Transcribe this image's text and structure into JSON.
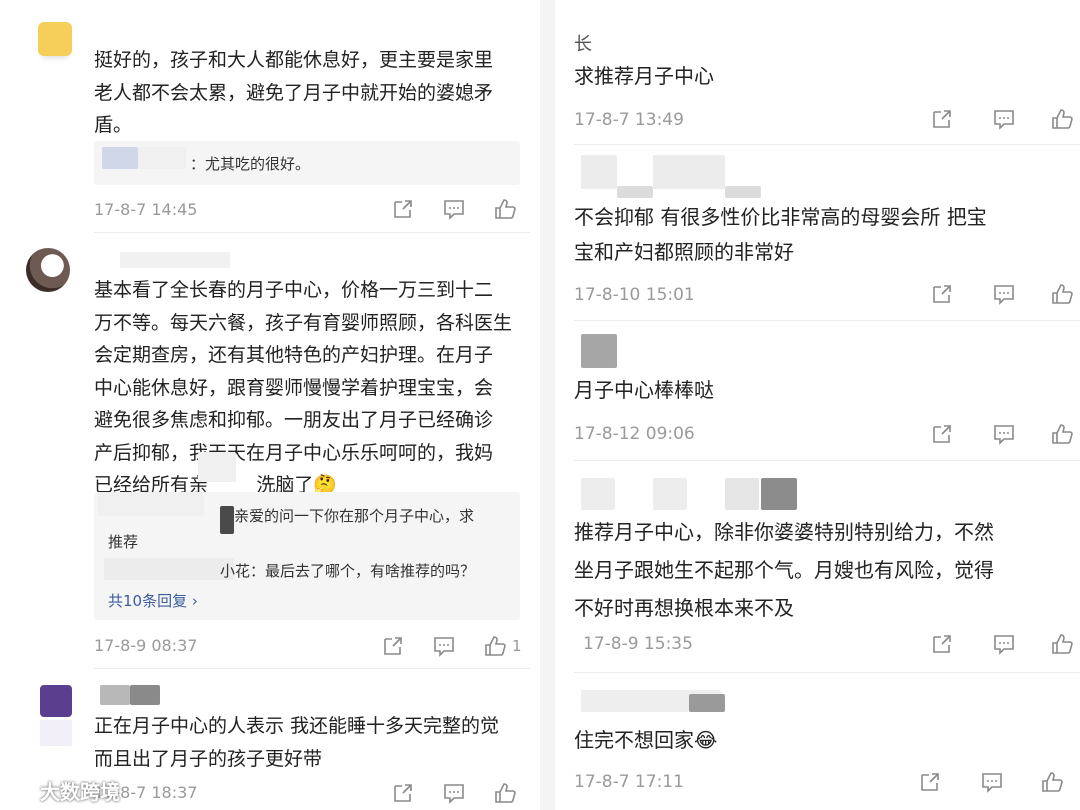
{
  "left": {
    "comments": [
      {
        "text": "挺好的，孩子和大人都能休息好，更主要是家里\n老人都不会太累，避免了月子中就开始的婆媳矛\n盾。",
        "reply": "：尤其吃的很好。",
        "time": "17-8-7 14:45"
      },
      {
        "text": "基本看了全长春的月子中心，价格一万三到十二\n万不等。每天六餐，孩子有育婴师照顾，各科医生\n会定期查房，还有其他特色的产妇护理。在月子\n中心能休息好，跟育婴师慢慢学着护理宝宝，会\n避免很多焦虑和抑郁。一朋友出了月子已经确诊\n产后抑郁，我天天在月子中心乐乐呵呵的，我妈\n已经给所有亲        洗脑了🤔",
        "replies": [
          "亲爱的问一下你在那个月子中心，求",
          "推荐",
          "小花：最后去了哪个，有啥推荐的吗？"
        ],
        "more_replies": "共10条回复 ›",
        "time": "17-8-9 08:37",
        "likes": "1"
      },
      {
        "text": "正在月子中心的人表示 我还能睡十多天完整的觉\n而且出了月子的孩子更好带",
        "time": "17-8-7 18:37"
      }
    ]
  },
  "right": {
    "comments": [
      {
        "name": "长",
        "text": "求推荐月子中心",
        "time": "17-8-7 13:49"
      },
      {
        "text": "不会抑郁 有很多性价比非常高的母婴会所 把宝\n宝和产妇都照顾的非常好",
        "time": "17-8-10 15:01"
      },
      {
        "text": "月子中心棒棒哒",
        "time": "17-8-12 09:06"
      },
      {
        "text": "推荐月子中心，除非你婆婆特别特别给力，不然\n坐月子跟她生不起那个气。月嫂也有风险，觉得\n不好时再想换根本来不及",
        "time": "17-8-9 15:35"
      },
      {
        "text": "住完不想回家😂",
        "time": "17-8-7 17:11"
      }
    ]
  },
  "watermark": "大数跨境",
  "colors": {
    "time": "#9a9a9a",
    "reply_bg": "#f5f5f5",
    "reply_link": "#3b5c9e",
    "text": "#222222"
  }
}
